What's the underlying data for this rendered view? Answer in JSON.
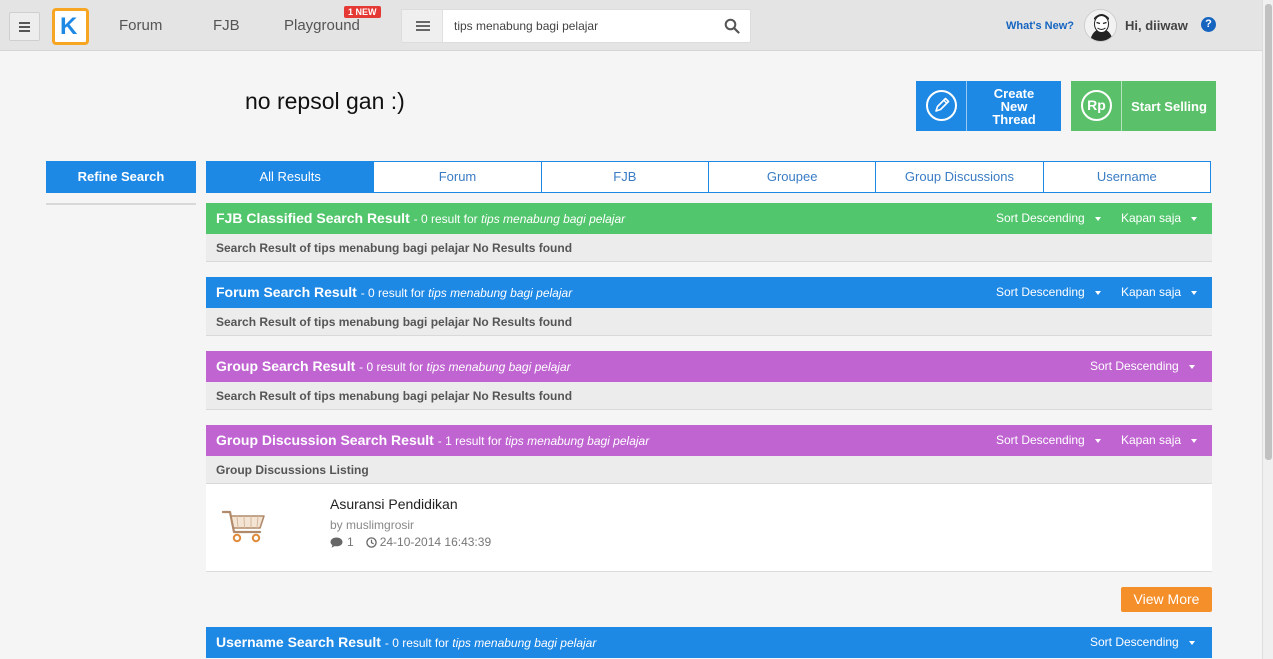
{
  "topbar": {
    "nav": [
      {
        "label": "Forum"
      },
      {
        "label": "FJB"
      },
      {
        "label": "Playground",
        "badge": "1 NEW"
      }
    ],
    "search": {
      "value": "tips menabung bagi pelajar",
      "placeholder": ""
    },
    "whats_new": "What's New?",
    "greeting": "Hi, diiwaw",
    "help": "?",
    "logo_letter": "K"
  },
  "page": {
    "title": "no repsol gan :)"
  },
  "actions": {
    "create_thread": "Create New Thread",
    "start_selling": "Start Selling",
    "sell_icon_text": "Rp"
  },
  "sidebar": {
    "refine_label": "Refine Search"
  },
  "tabs": [
    {
      "label": "All Results",
      "active": true
    },
    {
      "label": "Forum",
      "active": false
    },
    {
      "label": "FJB",
      "active": false
    },
    {
      "label": "Groupee",
      "active": false
    },
    {
      "label": "Group Discussions",
      "active": false
    },
    {
      "label": "Username",
      "active": false
    }
  ],
  "sections": {
    "fjb": {
      "title": "FJB Classified Search Result",
      "count_text": "- 0 result for",
      "query": "tips menabung bagi pelajar",
      "sort": "Sort Descending",
      "time": "Kapan saja",
      "message": "Search Result of tips menabung bagi pelajar No Results found",
      "color": "#52c66c"
    },
    "forum": {
      "title": "Forum Search Result",
      "count_text": "- 0 result for",
      "query": "tips menabung bagi pelajar",
      "sort": "Sort Descending",
      "time": "Kapan saja",
      "message": "Search Result of tips menabung bagi pelajar No Results found",
      "color": "#1e88e5"
    },
    "group": {
      "title": "Group Search Result",
      "count_text": "- 0 result for",
      "query": "tips menabung bagi pelajar",
      "sort": "Sort Descending",
      "message": "Search Result of tips menabung bagi pelajar No Results found",
      "color": "#c064d2"
    },
    "group_discussion": {
      "title": "Group Discussion Search Result",
      "count_text": "- 1 result for",
      "query": "tips menabung bagi pelajar",
      "sort": "Sort Descending",
      "time": "Kapan saja",
      "listing_header": "Group Discussions Listing",
      "color": "#c064d2",
      "items": [
        {
          "title": "Asuransi Pendidikan",
          "by_label": "by",
          "author": "muslimgrosir",
          "comments": "1",
          "datetime": "24-10-2014 16:43:39",
          "thumbnail_icon": "shopping-cart-icon"
        }
      ],
      "view_more": "View More"
    },
    "username": {
      "title": "Username Search Result",
      "count_text": "- 0 result for",
      "query": "tips menabung bagi pelajar",
      "sort": "Sort Descending",
      "color": "#1e88e5"
    }
  },
  "colors": {
    "accent_blue": "#1e88e5",
    "green": "#52c66c",
    "purple": "#c064d2",
    "orange": "#f58f2a",
    "logo_border": "#f6a623"
  }
}
